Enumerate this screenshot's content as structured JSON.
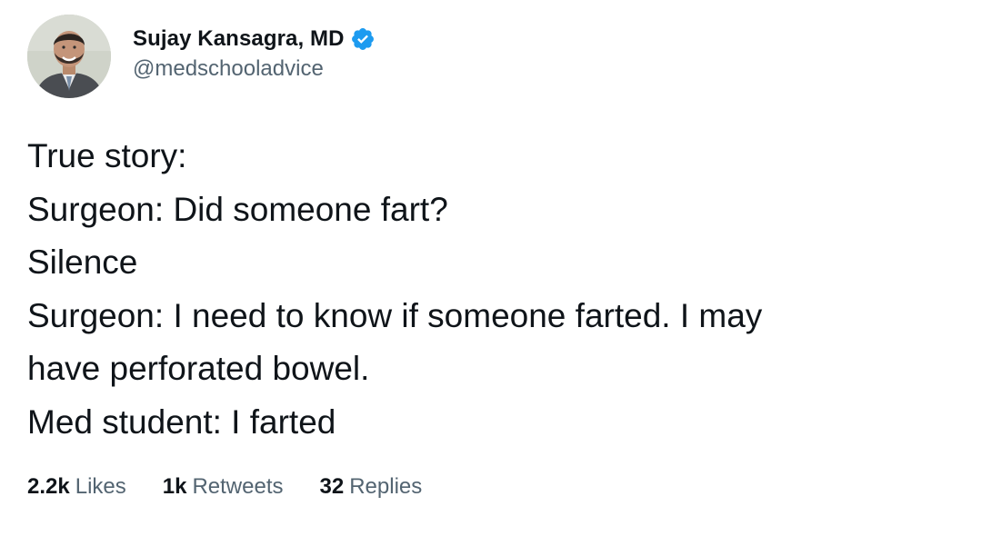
{
  "author": {
    "display_name": "Sujay Kansagra, MD",
    "handle": "@medschooladvice",
    "verified_color": "#1d9bf0"
  },
  "tweet": {
    "lines": [
      "True story:",
      "Surgeon: Did someone fart?",
      "Silence",
      "Surgeon: I need to know if someone farted. I may",
      "have perforated bowel.",
      "Med student: I farted"
    ]
  },
  "stats": {
    "likes": {
      "count": "2.2k",
      "label": "Likes"
    },
    "retweets": {
      "count": "1k",
      "label": "Retweets"
    },
    "replies": {
      "count": "32",
      "label": "Replies"
    }
  }
}
